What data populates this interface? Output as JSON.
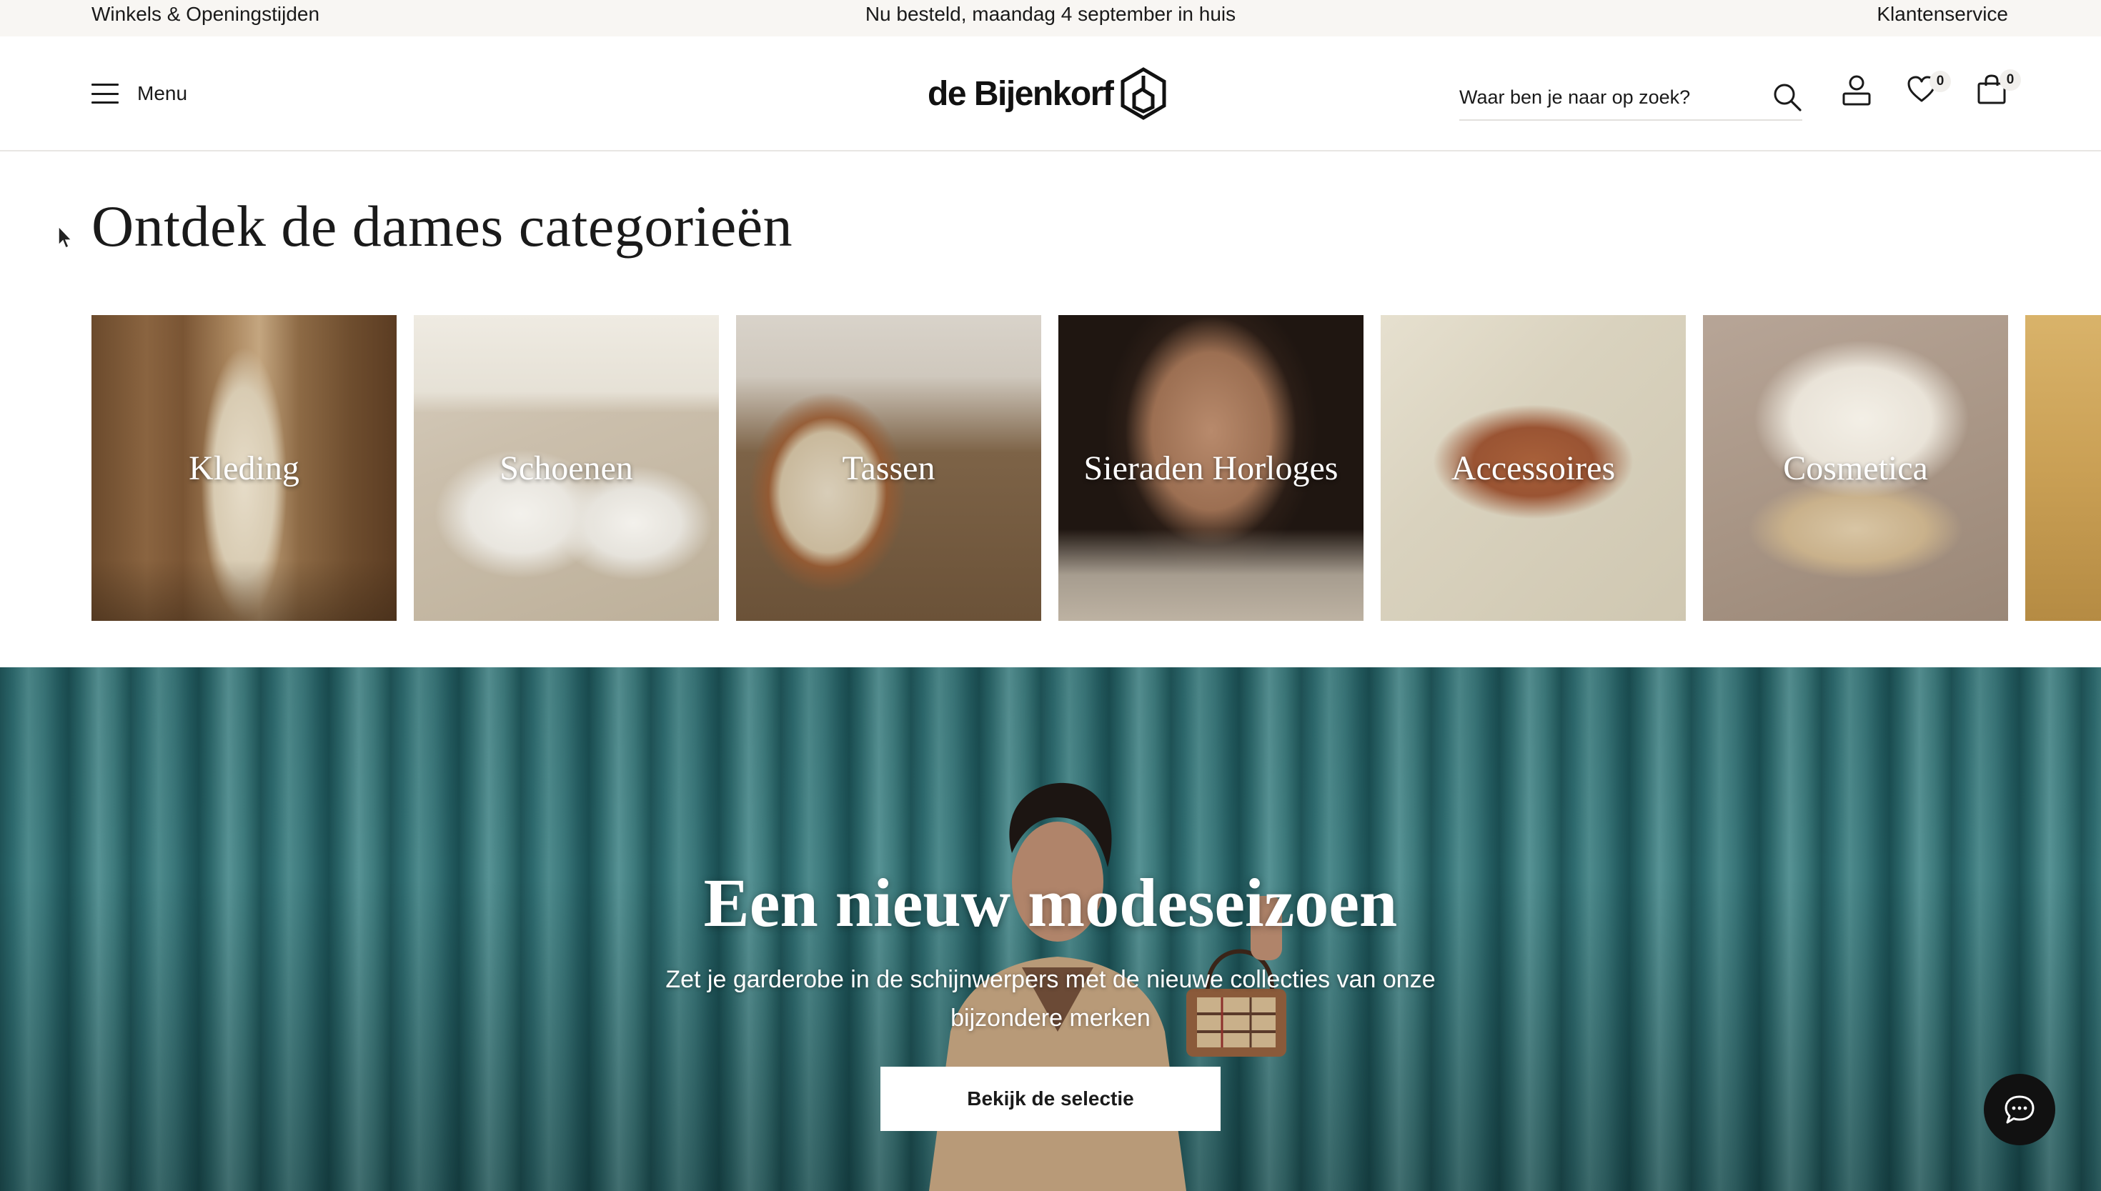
{
  "topbar": {
    "stores_link": "Winkels & Openingstijden",
    "delivery_message": "Nu besteld, maandag 4 september in huis",
    "service_link": "Klantenservice"
  },
  "header": {
    "menu_label": "Menu",
    "logo_text": "de Bijenkorf",
    "search_placeholder": "Waar ben je naar op zoek?",
    "wishlist_count": "0",
    "cart_count": "0"
  },
  "categories": {
    "title": "Ontdek de dames categorieën",
    "items": [
      {
        "label": "Kleding",
        "icon": "clothing-photo"
      },
      {
        "label": "Schoenen",
        "icon": "shoes-photo"
      },
      {
        "label": "Tassen",
        "icon": "bags-photo"
      },
      {
        "label": "Sieraden Horloges",
        "icon": "jewelry-photo"
      },
      {
        "label": "Accessoires",
        "icon": "accessories-photo"
      },
      {
        "label": "Cosmetica",
        "icon": "cosmetics-photo"
      }
    ]
  },
  "hero": {
    "title": "Een nieuw modeseizoen",
    "text": "Zet je garderobe in de schijnwerpers met de nieuwe collecties van onze bijzondere merken",
    "button_label": "Bekijk de selectie"
  },
  "colors": {
    "topbar_bg": "#f8f6f3",
    "hero_curtain": "#2f6b6e",
    "button_bg": "#ffffff",
    "chat_bg": "#111111"
  }
}
